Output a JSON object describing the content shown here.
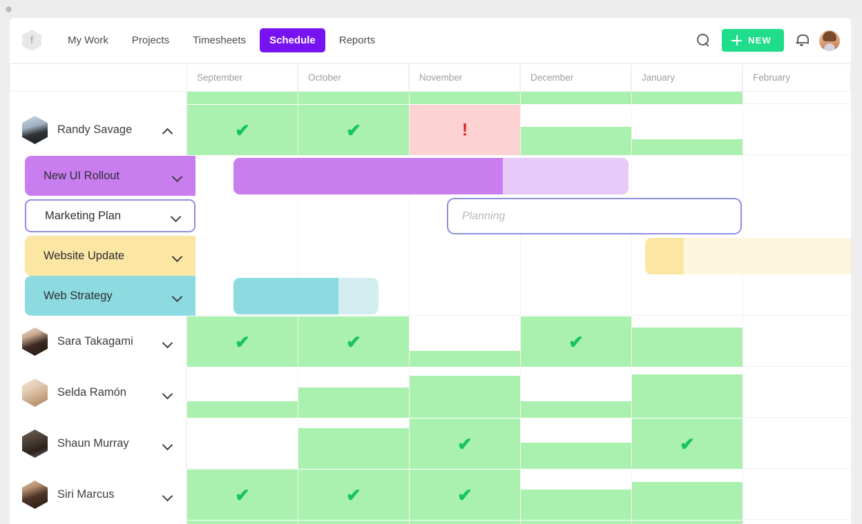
{
  "window": {
    "dot_icon": "hexagon-dot"
  },
  "nav": {
    "logo_glyph": "f",
    "links": [
      {
        "label": "My Work",
        "active": false
      },
      {
        "label": "Projects",
        "active": false
      },
      {
        "label": "Timesheets",
        "active": false
      },
      {
        "label": "Schedule",
        "active": true
      },
      {
        "label": "Reports",
        "active": false
      }
    ],
    "search_icon": "search-icon",
    "new_button": "NEW",
    "bell_icon": "bell-icon",
    "avatar": "user-avatar"
  },
  "timeline": {
    "months": [
      "September",
      "October",
      "November",
      "December",
      "January",
      "February"
    ],
    "colors": {
      "available": "#aaf0ae",
      "overbooked": "#fcd2d2",
      "check": "#16c464",
      "warning": "#e02020",
      "accent": "#7712f0",
      "new_button": "#1fdd8a",
      "selection_border": "#8d8ede"
    }
  },
  "rows": [
    {
      "type": "person",
      "name": "Randy Savage",
      "expanded": true,
      "chevron": "chevron-up-icon",
      "cells": [
        {
          "month": "September",
          "status": "available",
          "mark": "✔"
        },
        {
          "month": "October",
          "status": "available",
          "mark": "✔"
        },
        {
          "month": "November",
          "status": "overbooked",
          "mark": "!"
        },
        {
          "month": "December",
          "status": "available",
          "mark": ""
        },
        {
          "month": "January",
          "status": "available",
          "mark": ""
        }
      ]
    },
    {
      "type": "project",
      "name": "New UI Rollout",
      "chevron": "chevron-down-icon",
      "color": "#c97ef0",
      "color_light": "#e8caf9",
      "selected": false
    },
    {
      "type": "project",
      "name": "Marketing Plan",
      "chevron": "chevron-down-icon",
      "color": "#ffffff",
      "color_light": "#ffffff",
      "selected": true,
      "bar_label": "Planning"
    },
    {
      "type": "project",
      "name": "Website Update",
      "chevron": "chevron-down-icon",
      "color": "#fbe6a4",
      "color_light": "#fdf6dd",
      "selected": false
    },
    {
      "type": "project",
      "name": "Web Strategy",
      "chevron": "chevron-down-icon",
      "color": "#8ddbe0",
      "color_light": "#d2eef0",
      "selected": false
    },
    {
      "type": "person",
      "name": "Sara Takagami",
      "expanded": false,
      "chevron": "chevron-down-icon",
      "cells": [
        {
          "month": "September",
          "status": "available",
          "mark": "✔"
        },
        {
          "month": "October",
          "status": "available",
          "mark": "✔"
        },
        {
          "month": "November",
          "status": "available",
          "mark": ""
        },
        {
          "month": "December",
          "status": "available",
          "mark": "✔"
        },
        {
          "month": "January",
          "status": "available",
          "mark": ""
        }
      ]
    },
    {
      "type": "person",
      "name": "Selda Ramón",
      "expanded": false,
      "chevron": "chevron-down-icon",
      "cells": [
        {
          "month": "September",
          "status": "available",
          "mark": ""
        },
        {
          "month": "October",
          "status": "available",
          "mark": ""
        },
        {
          "month": "November",
          "status": "available",
          "mark": ""
        },
        {
          "month": "December",
          "status": "available",
          "mark": ""
        },
        {
          "month": "January",
          "status": "available",
          "mark": ""
        }
      ]
    },
    {
      "type": "person",
      "name": "Shaun Murray",
      "expanded": false,
      "chevron": "chevron-down-icon",
      "cells": [
        {
          "month": "September",
          "status": "none",
          "mark": ""
        },
        {
          "month": "October",
          "status": "available",
          "mark": ""
        },
        {
          "month": "November",
          "status": "available",
          "mark": "✔"
        },
        {
          "month": "December",
          "status": "available",
          "mark": ""
        },
        {
          "month": "January",
          "status": "available",
          "mark": "✔"
        }
      ]
    },
    {
      "type": "person",
      "name": "Siri Marcus",
      "expanded": false,
      "chevron": "chevron-down-icon",
      "cells": [
        {
          "month": "September",
          "status": "available",
          "mark": "✔"
        },
        {
          "month": "October",
          "status": "available",
          "mark": "✔"
        },
        {
          "month": "November",
          "status": "available",
          "mark": "✔"
        },
        {
          "month": "December",
          "status": "available",
          "mark": ""
        },
        {
          "month": "January",
          "status": "available",
          "mark": ""
        }
      ]
    }
  ]
}
